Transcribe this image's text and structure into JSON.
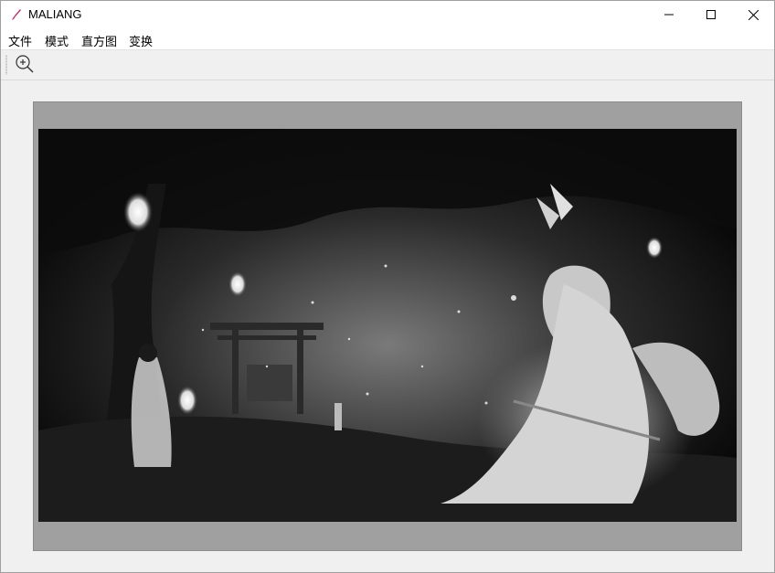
{
  "window": {
    "title": "MALIANG",
    "controls": [
      "minimize-icon",
      "maximize-icon",
      "close-icon"
    ]
  },
  "menu": {
    "items": [
      {
        "label": "文件"
      },
      {
        "label": "模式"
      },
      {
        "label": "直方图"
      },
      {
        "label": "变换"
      }
    ]
  },
  "toolbar": {
    "tools": [
      {
        "icon": "zoom-in-icon"
      }
    ]
  },
  "canvas": {
    "image_description_icon": "photo-image",
    "colors": {
      "frame": "#a0a0a0",
      "background": "#f0f0f0",
      "accent": "#d03070"
    }
  }
}
